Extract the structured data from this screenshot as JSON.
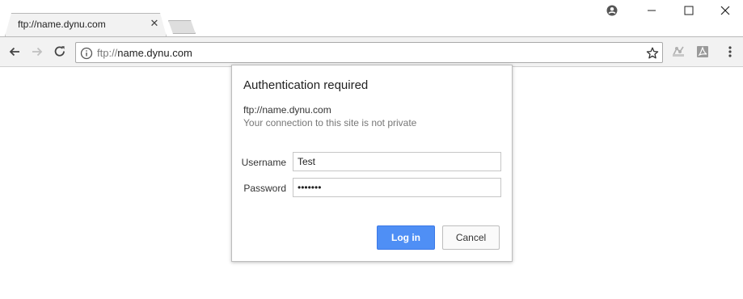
{
  "browser": {
    "tab": {
      "title": "ftp://name.dynu.com",
      "close_glyph": "✕"
    },
    "window_controls": [
      "account-icon",
      "minimize-icon",
      "maximize-icon",
      "close-icon"
    ],
    "toolbar": {
      "url_scheme": "ftp://",
      "url_host": "name.dynu.com",
      "icons": [
        "back-icon",
        "forward-icon",
        "reload-icon",
        "info-icon",
        "star-icon",
        "extension-icon",
        "pdf-icon",
        "menu-icon"
      ]
    }
  },
  "dialog": {
    "title": "Authentication required",
    "origin": "ftp://name.dynu.com",
    "warning": "Your connection to this site is not private",
    "username_label": "Username",
    "username_value": "Test",
    "password_label": "Password",
    "password_value": "•••••••",
    "login_label": "Log in",
    "cancel_label": "Cancel"
  },
  "colors": {
    "primary_button": "#4f8ff5",
    "toolbar_bg": "#f2f2f2"
  }
}
